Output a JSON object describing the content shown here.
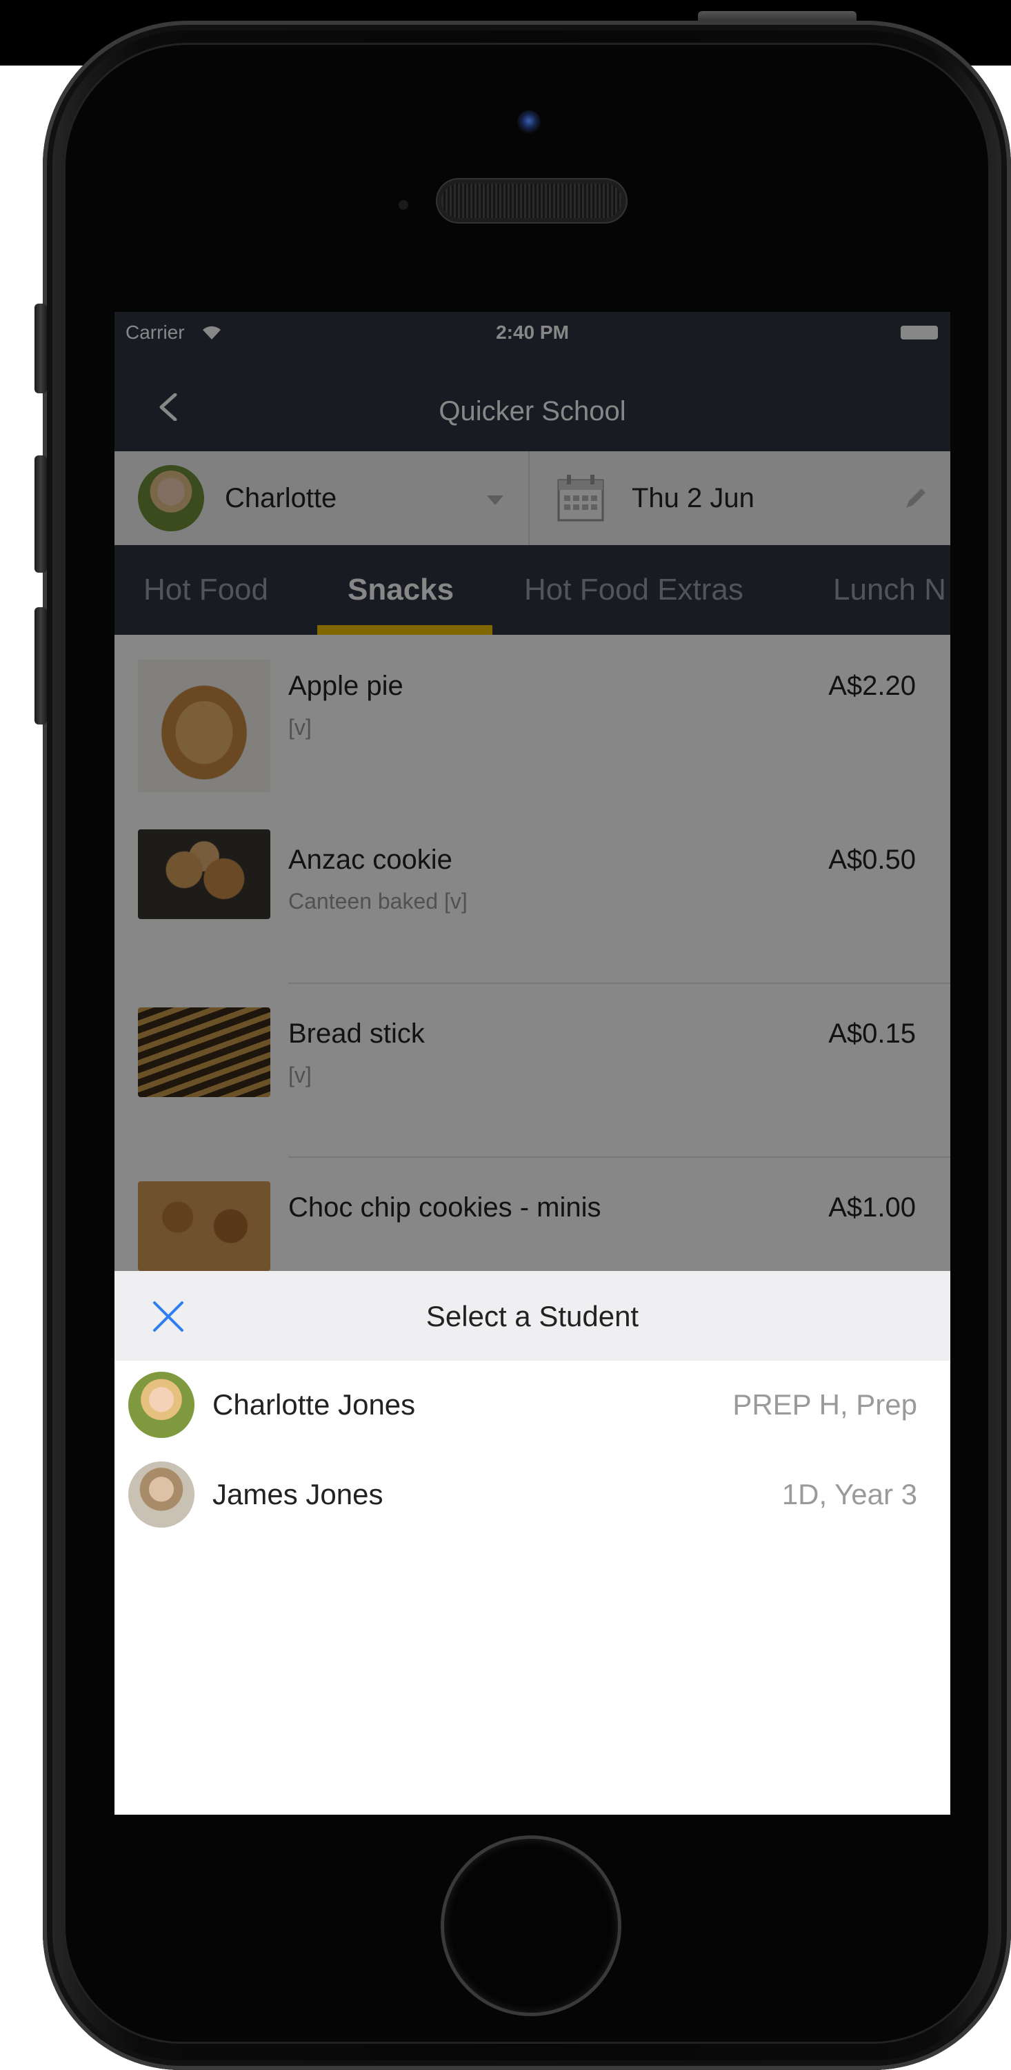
{
  "status_bar": {
    "carrier": "Carrier",
    "time": "2:40 PM"
  },
  "nav": {
    "title": "Quicker School",
    "back_icon": "chevron-left-icon"
  },
  "selector": {
    "student_name": "Charlotte",
    "date": "Thu 2 Jun"
  },
  "tabs": [
    {
      "label": "Hot Food",
      "active": false
    },
    {
      "label": "Snacks",
      "active": true
    },
    {
      "label": "Hot Food Extras",
      "active": false
    },
    {
      "label": "Lunch N",
      "active": false
    }
  ],
  "menu_items": [
    {
      "name": "Apple pie",
      "desc": "[v]",
      "price": "A$2.20"
    },
    {
      "name": "Anzac cookie",
      "desc": "Canteen baked [v]",
      "price": "A$0.50"
    },
    {
      "name": "Bread stick",
      "desc": "[v]",
      "price": "A$0.15"
    },
    {
      "name": "Choc chip cookies - minis",
      "desc": "",
      "price": "A$1.00"
    }
  ],
  "sheet": {
    "title": "Select a Student"
  },
  "students": [
    {
      "name": "Charlotte  Jones",
      "class": "PREP H, Prep"
    },
    {
      "name": "James Jones",
      "class": "1D, Year 3"
    }
  ],
  "colors": {
    "nav_bg": "#2f3540",
    "tab_indicator": "#f2c200",
    "close_icon": "#2f7ef0"
  }
}
